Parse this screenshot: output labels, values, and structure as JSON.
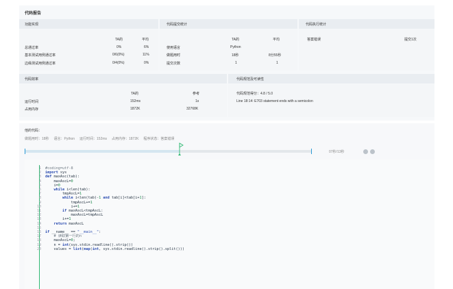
{
  "report_title": "代码报告",
  "functional": {
    "title": "功能实现",
    "col_ta": "TA的",
    "col_avg": "平均",
    "rows": [
      {
        "label": "总通过率",
        "ta": "0%",
        "avg": "6%"
      },
      {
        "label": "基本测试用例通过率",
        "ta": "0/6(0%)",
        "avg": "11%"
      },
      {
        "label": "边缘测试用例通过率",
        "ta": "0/4(0%)",
        "avg": "0%"
      }
    ]
  },
  "submission": {
    "title": "代码提交统计",
    "col_ta": "TA的",
    "col_avg": "平均",
    "rows": [
      {
        "label": "使用语言",
        "ta": "Python",
        "avg": ""
      },
      {
        "label": "做题用时",
        "ta": "18秒",
        "avg": "8分55秒"
      },
      {
        "label": "提交次数",
        "ta": "1",
        "avg": "1"
      }
    ]
  },
  "execution": {
    "title": "代码执行统计",
    "status": "答案错误",
    "count": "提交1次"
  },
  "efficiency": {
    "title": "代码效率",
    "col_ta": "TA的",
    "col_ref": "参考",
    "rows": [
      {
        "label": "运行时间",
        "ta": "152ms",
        "ref": "1s"
      },
      {
        "label": "占用内存",
        "ta": "1872K",
        "ref": "32768K"
      }
    ]
  },
  "style": {
    "title": "代码规范及可读性",
    "score_label": "代码规范得分：",
    "score": "4.8 / 5.0",
    "issue": "Line 18:14: E703 statement ends with a semicolon"
  },
  "my_code": {
    "title": "他的代码：",
    "meta": "做题用时：18秒     语言：Python     运行时间：152ms     占用内存：1872K     程序状态：答案错误"
  },
  "timeline": {
    "time": "07秒/13秒",
    "progress": 0.54
  },
  "code_lines": [
    {
      "n": "1",
      "t": "#coding=utf-8"
    },
    {
      "n": "2",
      "t": "import sys"
    },
    {
      "n": "3",
      "t": "def maxAsc(tab):"
    },
    {
      "n": "4",
      "t": "    maxAscL=0"
    },
    {
      "n": "5",
      "t": "    i=0"
    },
    {
      "n": "6",
      "t": "    while i<len(tab):"
    },
    {
      "n": "7",
      "t": "        tmpAscL=1"
    },
    {
      "n": "8",
      "t": "        while i<len(tab)-1 and tab[i]<tab[i+1]:"
    },
    {
      "n": "9",
      "t": "            tmpAscL+=1"
    },
    {
      "n": "10",
      "t": "            i+=1"
    },
    {
      "n": "11",
      "t": "        if maxAscL<tmpAscL:"
    },
    {
      "n": "12",
      "t": "            maxAscL=tmpAscL"
    },
    {
      "n": "13",
      "t": "        i+=1"
    },
    {
      "n": "14",
      "t": "    return maxAscL"
    },
    {
      "n": "15",
      "t": ""
    },
    {
      "n": "16",
      "t": "if __name__ == \"__main__\":"
    },
    {
      "n": "17",
      "t": "    # 读取第一行的n"
    },
    {
      "n": "18",
      "t": "    maxAscL=0;"
    },
    {
      "n": "19",
      "t": "    n = int(sys.stdin.readline().strip())"
    },
    {
      "n": "20",
      "t": "    values = list(map(int, sys.stdin.readline().strip().split()))"
    }
  ],
  "colors": {
    "accent": "#2eb872",
    "panel": "#f4f6f8",
    "header": "#e9edf1"
  }
}
